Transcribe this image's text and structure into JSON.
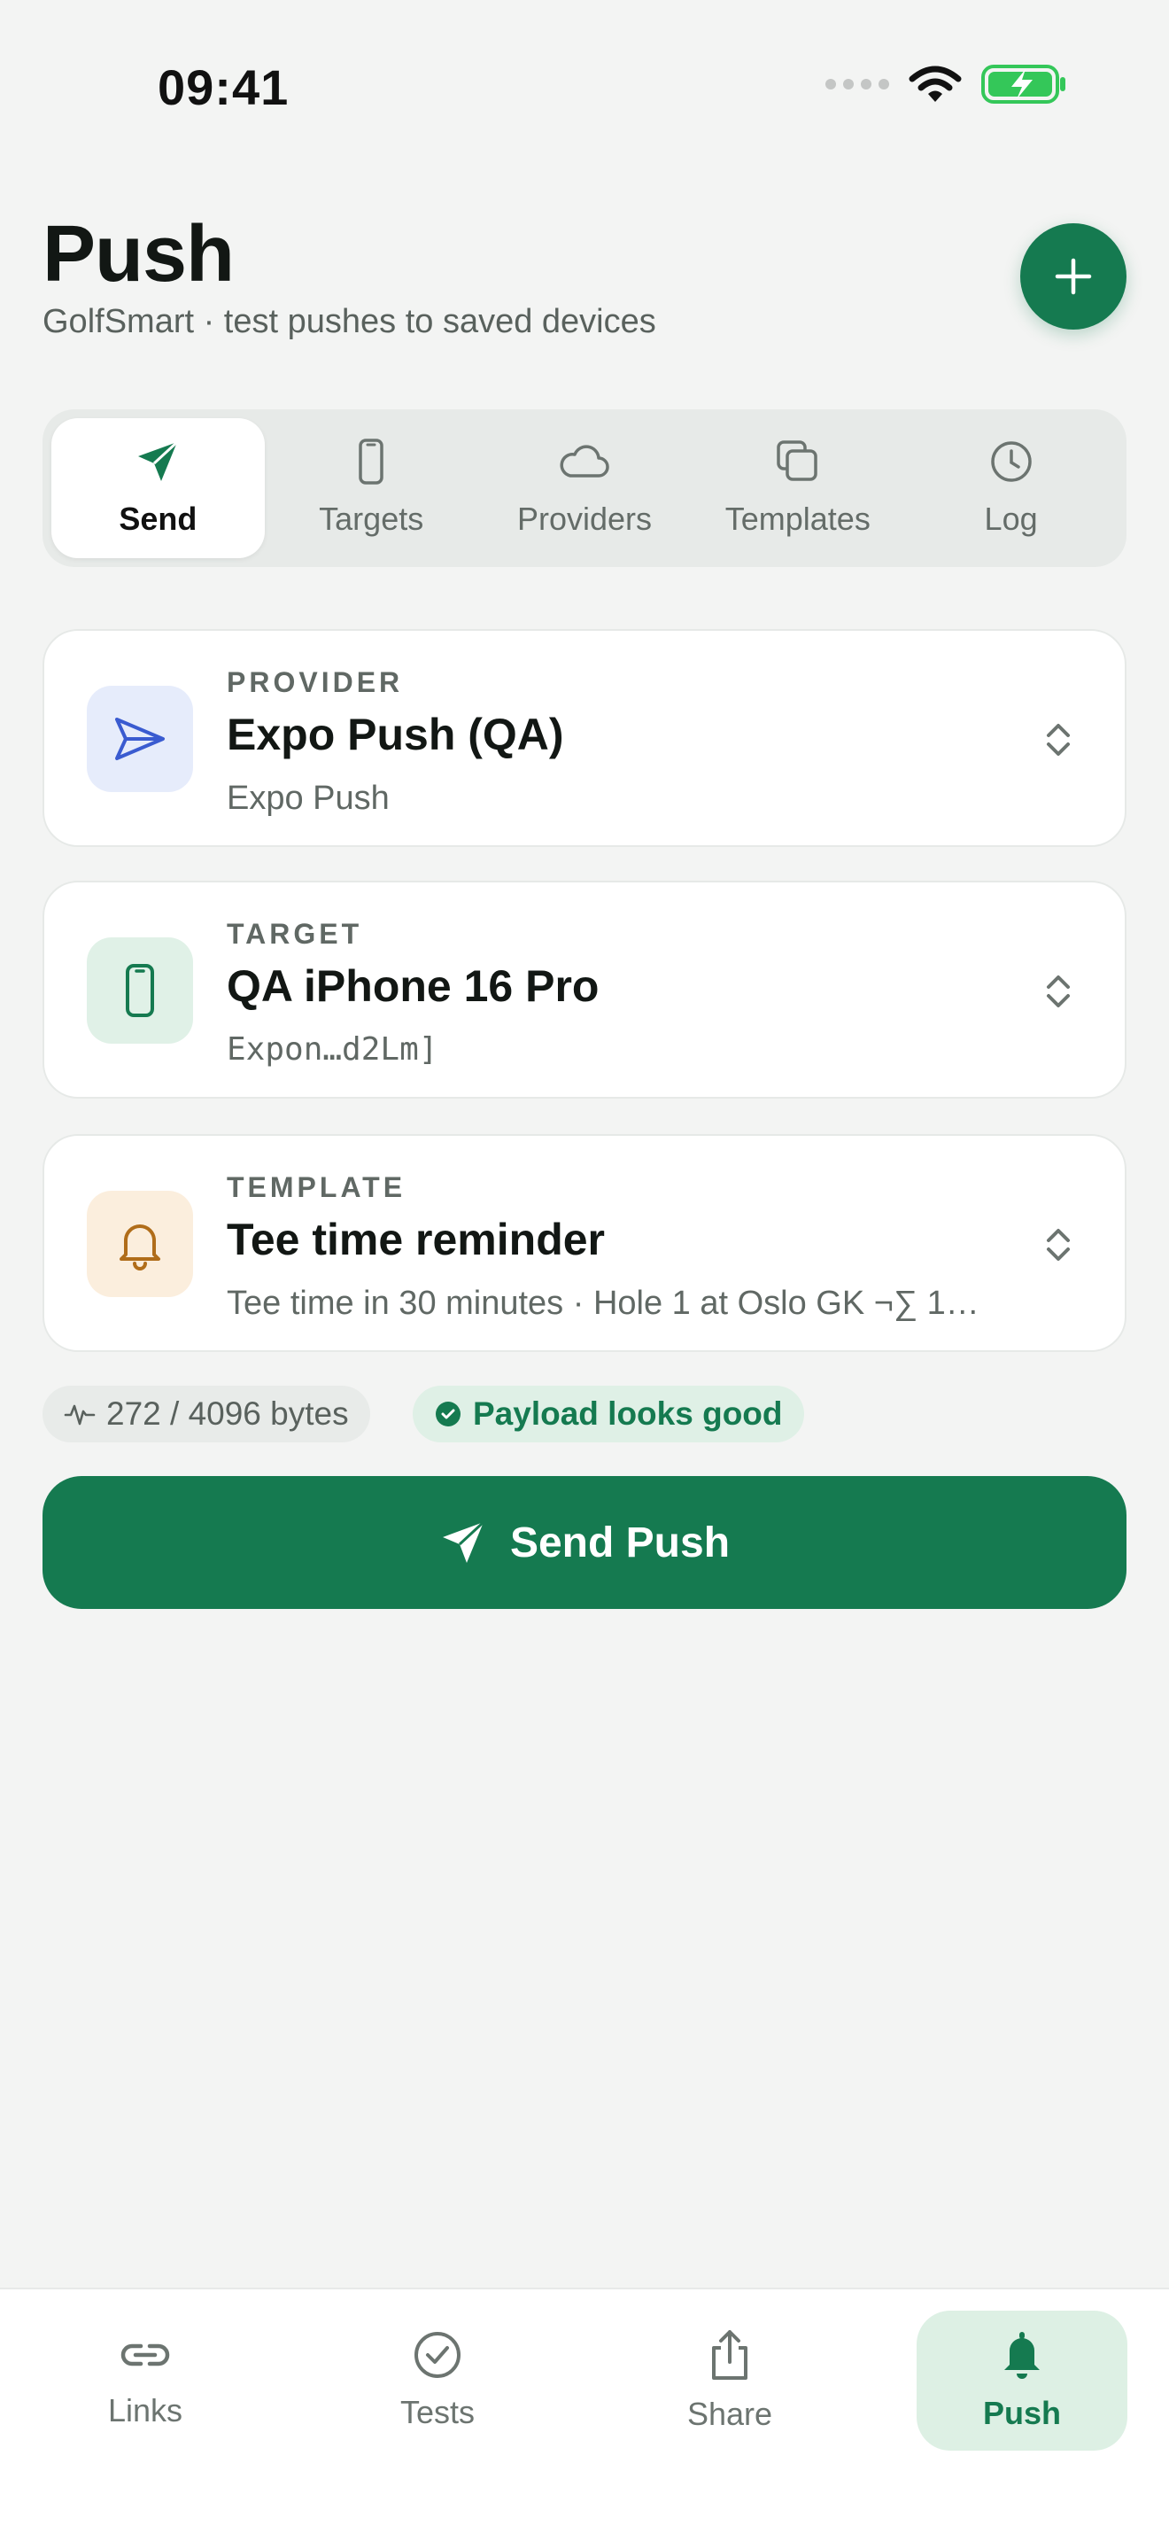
{
  "status": {
    "time": "09:41"
  },
  "header": {
    "title": "Push",
    "subtitle": "GolfSmart · test pushes to saved devices",
    "add_label": "+"
  },
  "segments": [
    {
      "label": "Send",
      "icon": "send-icon",
      "active": true
    },
    {
      "label": "Targets",
      "icon": "phone-icon",
      "active": false
    },
    {
      "label": "Providers",
      "icon": "cloud-icon",
      "active": false
    },
    {
      "label": "Templates",
      "icon": "copy-icon",
      "active": false
    },
    {
      "label": "Log",
      "icon": "clock-icon",
      "active": false
    }
  ],
  "cards": {
    "provider": {
      "kicker": "PROVIDER",
      "title": "Expo Push (QA)",
      "subtitle": "Expo Push",
      "icon": "paper-plane-icon",
      "icon_bg": "#e6ecfb",
      "icon_color": "#3a5bd0"
    },
    "target": {
      "kicker": "TARGET",
      "title": "QA iPhone 16 Pro",
      "subtitle": "Expon…d2Lm]",
      "icon": "phone-icon",
      "icon_bg": "#e0f1e7",
      "icon_color": "#157a50"
    },
    "template": {
      "kicker": "TEMPLATE",
      "title": "Tee time reminder",
      "subtitle": "Tee time in 30 minutes · Hole 1 at Oslo GK ¬∑ 1…",
      "icon": "bell-icon",
      "icon_bg": "#fbeedd",
      "icon_color": "#b06d1a"
    }
  },
  "payload": {
    "bytes_label": "272 / 4096 bytes",
    "status_label": "Payload looks good"
  },
  "send_button": {
    "label": "Send Push"
  },
  "tabbar": [
    {
      "label": "Links",
      "icon": "link-icon",
      "active": false
    },
    {
      "label": "Tests",
      "icon": "check-circle-icon",
      "active": false
    },
    {
      "label": "Share",
      "icon": "share-icon",
      "active": false
    },
    {
      "label": "Push",
      "icon": "bell-icon",
      "active": true
    }
  ],
  "colors": {
    "accent": "#157a50",
    "background": "#f3f4f3"
  }
}
